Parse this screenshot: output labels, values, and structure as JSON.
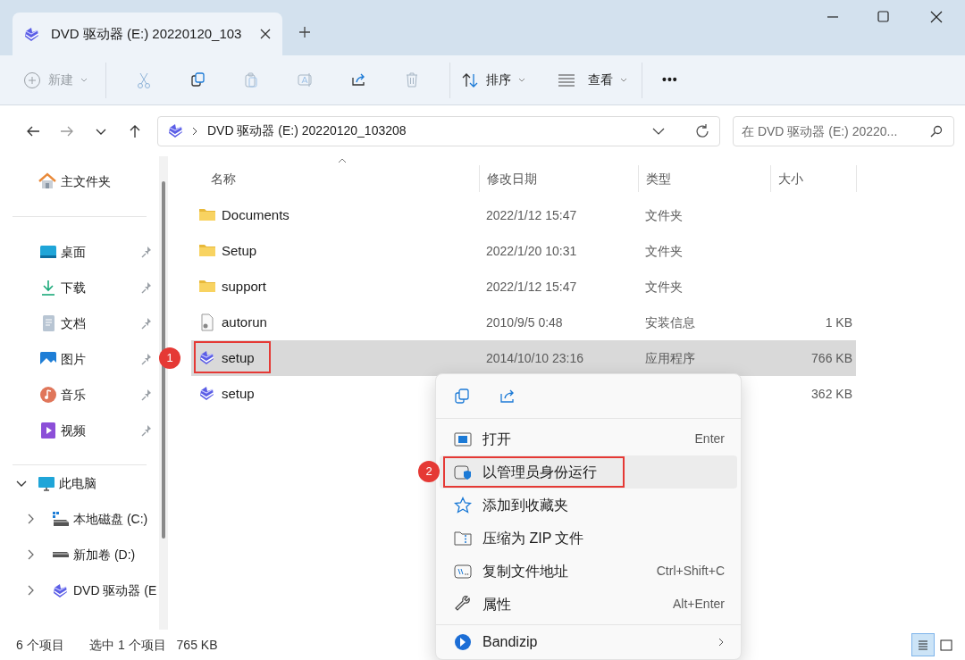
{
  "window": {
    "tab_title": "DVD 驱动器 (E:) 20220120_103"
  },
  "toolbar": {
    "new_label": "新建",
    "new_disabled": true,
    "sort_label": "排序",
    "view_label": "查看",
    "more": "•••"
  },
  "address": {
    "path": "DVD 驱动器 (E:) 20220120_103208",
    "search_placeholder": "在 DVD 驱动器 (E:) 20220..."
  },
  "sidebar": {
    "home": "主文件夹",
    "quick_access": [
      {
        "label": "桌面",
        "kind": "desktop",
        "pinned": true
      },
      {
        "label": "下载",
        "kind": "download",
        "pinned": true
      },
      {
        "label": "文档",
        "kind": "documents",
        "pinned": true
      },
      {
        "label": "图片",
        "kind": "pictures",
        "pinned": true
      },
      {
        "label": "音乐",
        "kind": "music",
        "pinned": true
      },
      {
        "label": "视频",
        "kind": "videos",
        "pinned": true
      }
    ],
    "tree": [
      {
        "label": "此电脑",
        "kind": "pc",
        "expanded": true,
        "children": [
          {
            "label": "本地磁盘 (C:)",
            "kind": "disk",
            "expanded": false
          },
          {
            "label": "新加卷 (D:)",
            "kind": "drive",
            "expanded": false
          },
          {
            "label": "DVD 驱动器 (E",
            "kind": "dvd",
            "expanded": false
          }
        ]
      }
    ]
  },
  "table": {
    "columns": [
      "名称",
      "修改日期",
      "类型",
      "大小"
    ],
    "rows": [
      {
        "name": "Documents",
        "kind": "folder",
        "date": "2022/1/12 15:47",
        "type": "文件夹",
        "selected": false
      },
      {
        "name": "Setup",
        "kind": "folder",
        "date": "2022/1/20 10:31",
        "type": "文件夹",
        "selected": false
      },
      {
        "name": "support",
        "kind": "folder",
        "date": "2022/1/12 15:47",
        "type": "文件夹",
        "selected": false
      },
      {
        "name": "autorun",
        "kind": "file",
        "date": "2010/9/5 0:48",
        "type": "安装信息",
        "size": "1 KB",
        "selected": false
      },
      {
        "name": "setup",
        "kind": "app",
        "date": "2014/10/10 23:16",
        "type": "应用程序",
        "size": "766 KB",
        "selected": true,
        "callout": "1"
      },
      {
        "name": "setup",
        "kind": "app",
        "size": "362 KB",
        "selected": false
      }
    ]
  },
  "context_menu": {
    "items": [
      {
        "label": "打开",
        "kind": "open",
        "shortcut": "Enter",
        "highlighted": false
      },
      {
        "label": "以管理员身份运行",
        "kind": "admin",
        "highlighted": true,
        "callout": "2"
      },
      {
        "label": "添加到收藏夹",
        "kind": "favorite",
        "highlighted": false
      },
      {
        "label": "压缩为 ZIP 文件",
        "kind": "zip",
        "highlighted": false
      },
      {
        "label": "复制文件地址",
        "kind": "copypath",
        "shortcut": "Ctrl+Shift+C",
        "highlighted": false
      },
      {
        "label": "属性",
        "kind": "properties",
        "shortcut": "Alt+Enter",
        "highlighted": false
      },
      {
        "label": "Bandizip",
        "kind": "bandizip",
        "submenu": true,
        "highlighted": false
      }
    ]
  },
  "status_bar": {
    "count": "6 个项目",
    "selection": "选中 1 个项目",
    "selection_size": "765 KB",
    "views": [
      {
        "kind": "details",
        "selected": true
      },
      {
        "kind": "tiles",
        "selected": false
      }
    ]
  }
}
